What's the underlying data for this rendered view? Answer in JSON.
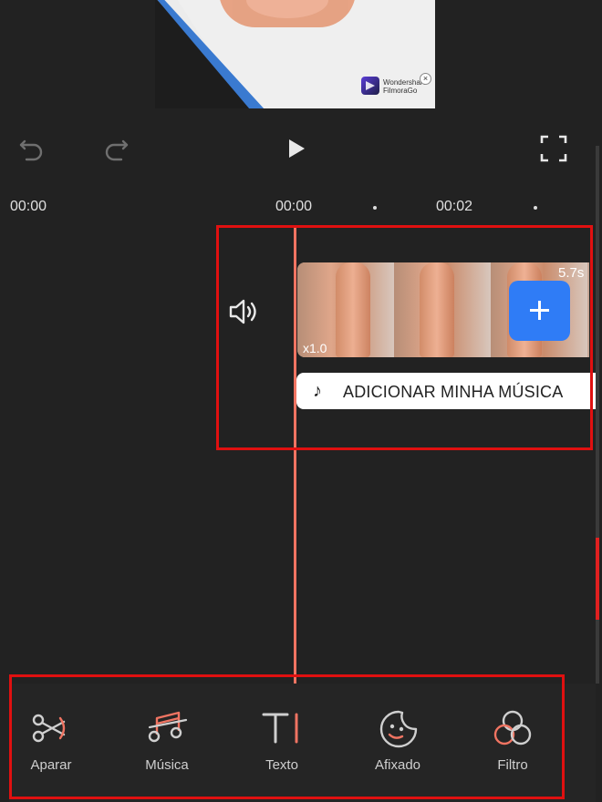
{
  "preview": {
    "watermark_line1": "Wondershare",
    "watermark_line2": "FilmoraGo",
    "close_glyph": "×"
  },
  "controls": {
    "undo_icon": "undo-icon",
    "redo_icon": "redo-icon",
    "play_icon": "play-icon",
    "fullscreen_icon": "fullscreen-icon"
  },
  "timeline": {
    "time_left": "00:00",
    "ruler": [
      "00:00",
      "00:02"
    ],
    "clip_speed": "x1.0",
    "clip_duration": "5.7s",
    "add_music_label": "ADICIONAR MINHA MÚSICA",
    "music_note_glyph": "♪"
  },
  "toolbar": {
    "items": [
      {
        "label": "Aparar",
        "icon": "scissors-icon"
      },
      {
        "label": "Música",
        "icon": "music-icon"
      },
      {
        "label": "Texto",
        "icon": "text-icon"
      },
      {
        "label": "Afixado",
        "icon": "sticker-icon"
      },
      {
        "label": "Filtro",
        "icon": "filter-icon"
      }
    ]
  },
  "colors": {
    "accent": "#f07462",
    "add_button": "#2f7cf6",
    "highlight_box": "#e01010",
    "background": "#222222"
  }
}
